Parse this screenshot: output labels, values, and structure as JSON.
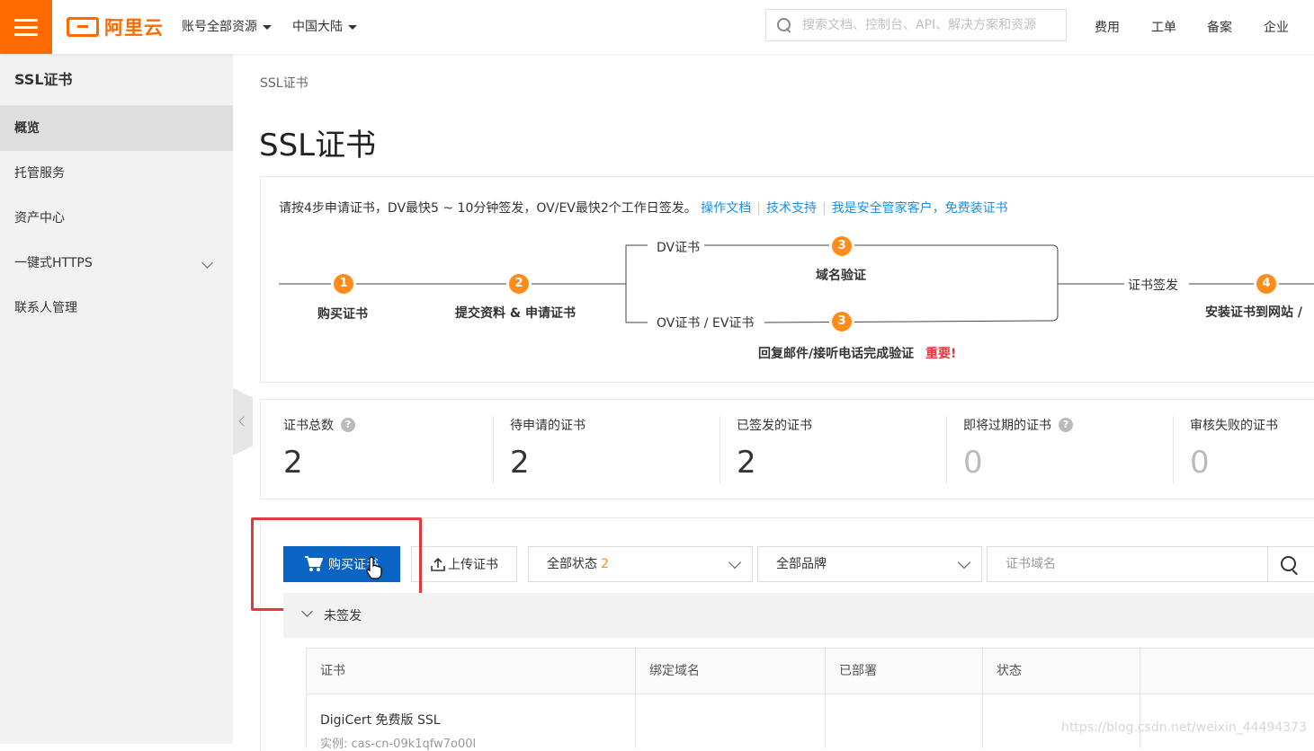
{
  "header": {
    "logo_text": "阿里云",
    "account_menu": "账号全部资源",
    "region_menu": "中国大陆",
    "search_placeholder": "搜索文档、控制台、API、解决方案和资源",
    "links": [
      "费用",
      "工单",
      "备案",
      "企业"
    ]
  },
  "sidebar": {
    "title": "SSL证书",
    "items": [
      {
        "label": "概览",
        "active": true
      },
      {
        "label": "托管服务"
      },
      {
        "label": "资产中心"
      },
      {
        "label": "一键式HTTPS",
        "expandable": true
      },
      {
        "label": "联系人管理"
      }
    ]
  },
  "breadcrumb": "SSL证书",
  "page_title": "SSL证书",
  "steps": {
    "intro": "请按4步申请证书，DV最快5 ~ 10分钟签发，OV/EV最快2个工作日签发。",
    "links": [
      "操作文档",
      "技术支持",
      "我是安全管家客户，免费装证书"
    ],
    "step1": "购买证书",
    "step2": "提交资料 & 申请证书",
    "dv_label": "DV证书",
    "dv_step": "域名验证",
    "ovev_label": "OV证书 / EV证书",
    "ovev_step": "回复邮件/接听电话完成验证",
    "important": "重要!",
    "issue_label": "证书签发",
    "step4": "安装证书到网站 /",
    "numbers": [
      "1",
      "2",
      "3",
      "3",
      "4"
    ]
  },
  "stats": [
    {
      "label": "证书总数",
      "value": "2",
      "help": true
    },
    {
      "label": "待申请的证书",
      "value": "2"
    },
    {
      "label": "已签发的证书",
      "value": "2"
    },
    {
      "label": "即将过期的证书",
      "value": "0",
      "help": true
    },
    {
      "label": "审核失败的证书",
      "value": "0"
    }
  ],
  "toolbar": {
    "buy_label": "购买证书",
    "upload_label": "上传证书",
    "status_select": "全部状态",
    "status_count": "2",
    "brand_select": "全部品牌",
    "domain_placeholder": "证书域名"
  },
  "group": {
    "label": "未签发"
  },
  "table": {
    "headers": [
      "证书",
      "绑定域名",
      "已部署",
      "状态",
      ""
    ],
    "rows": [
      {
        "cert": "DigiCert 免费版 SSL",
        "instance": "实例: cas-cn-09k1qfw7o00l"
      }
    ]
  },
  "watermark": "https://blog.csdn.net/weixin_44494373",
  "colors": {
    "brand": "#ff6a00",
    "primary": "#0a64c4",
    "step": "#ff8c1a",
    "link": "#1a8fe3",
    "highlight": "#e4393c"
  }
}
